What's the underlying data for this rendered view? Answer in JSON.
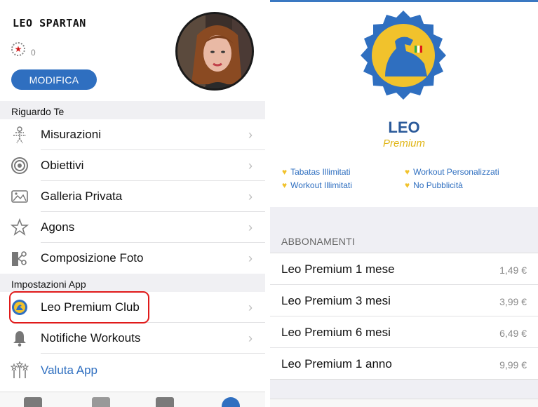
{
  "profile": {
    "username": "LEO SPARTAN",
    "star_count": "0",
    "edit_label": "MODIFICA"
  },
  "sections": {
    "about": "Riguardo Te",
    "settings": "Impostazioni App"
  },
  "menu": {
    "items": [
      {
        "label": "Misurazioni",
        "icon": "body-measure-icon"
      },
      {
        "label": "Obiettivi",
        "icon": "target-icon"
      },
      {
        "label": "Galleria Privata",
        "icon": "gallery-icon"
      },
      {
        "label": "Agons",
        "icon": "star-outline-icon"
      },
      {
        "label": "Composizione Foto",
        "icon": "photo-composition-icon"
      }
    ],
    "settings_items": [
      {
        "label": "Leo Premium Club",
        "icon": "premium-badge-icon"
      },
      {
        "label": "Notifiche Workouts",
        "icon": "bell-icon"
      },
      {
        "label": "Valuta App",
        "icon": "rate-app-icon"
      }
    ]
  },
  "premium": {
    "title": "LEO",
    "subtitle": "Premium",
    "features": [
      "Tabatas Illimitati",
      "Workout Personalizzati",
      "Workout Illimitati",
      "No Pubblicità"
    ],
    "subscriptions_header": "ABBONAMENTI",
    "plans": [
      {
        "name": "Leo Premium 1 mese",
        "price": "1,49 €"
      },
      {
        "name": "Leo Premium 3 mesi",
        "price": "3,99 €"
      },
      {
        "name": "Leo Premium 6 mesi",
        "price": "6,49 €"
      },
      {
        "name": "Leo Premium 1 anno",
        "price": "9,99 €"
      }
    ]
  },
  "colors": {
    "accent": "#2f6fc0",
    "premium_gold": "#e0b516",
    "highlight_red": "#e01a1a"
  }
}
